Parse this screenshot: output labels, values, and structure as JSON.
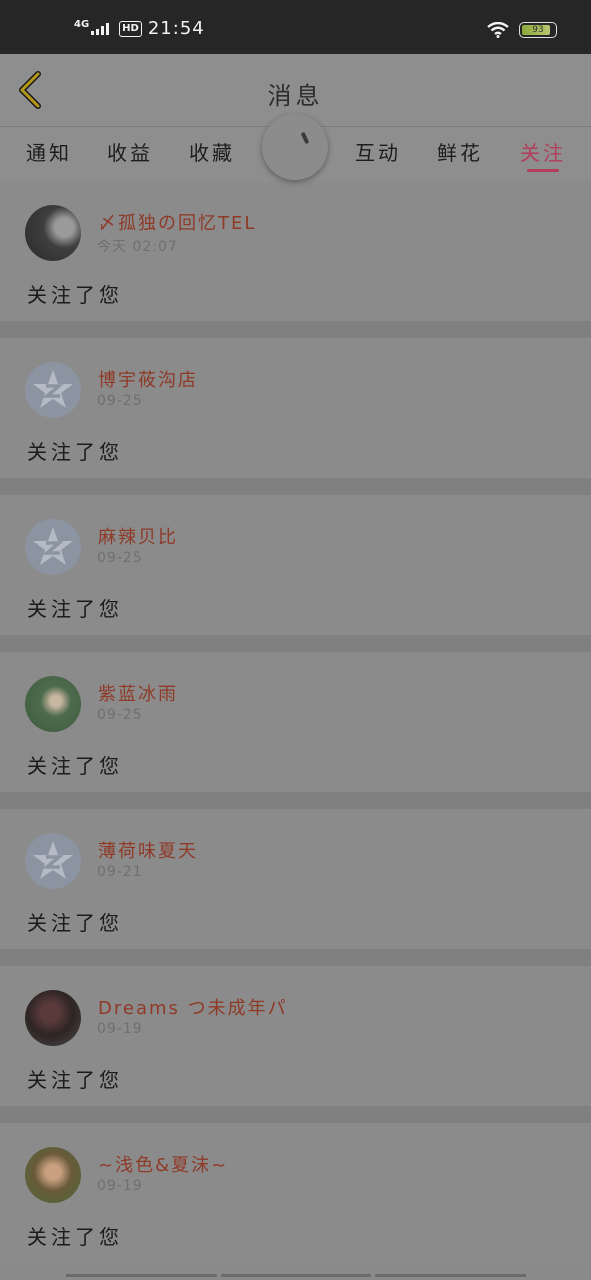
{
  "status_bar": {
    "network": "4G",
    "hd": "HD",
    "time": "21:54",
    "battery": "93",
    "icons": [
      "signal-icon",
      "wifi-icon",
      "battery-icon"
    ]
  },
  "header": {
    "title": "消息",
    "back_icon": "chevron-left-icon"
  },
  "tabs": [
    {
      "label": "通知"
    },
    {
      "label": "收益"
    },
    {
      "label": "收藏"
    },
    {
      "label": "互动"
    },
    {
      "label": "鲜花"
    },
    {
      "label": "关注",
      "active": true
    }
  ],
  "feed": [
    {
      "name": "〆孤独の回忆TEL",
      "time": "今天 02:07",
      "message": "关注了您",
      "avatar": "photo-avatar"
    },
    {
      "name": "博宇莜沟店",
      "time": "09-25",
      "message": "关注了您",
      "avatar": "qq-default-avatar"
    },
    {
      "name": "麻辣贝比",
      "time": "09-25",
      "message": "关注了您",
      "avatar": "qq-default-avatar"
    },
    {
      "name": "紫蓝冰雨",
      "time": "09-25",
      "message": "关注了您",
      "avatar": "photo-avatar"
    },
    {
      "name": "薄荷味夏天",
      "time": "09-21",
      "message": "关注了您",
      "avatar": "qq-default-avatar"
    },
    {
      "name": "Dreams つ未成年パ",
      "time": "09-19",
      "message": "关注了您",
      "avatar": "photo-avatar"
    },
    {
      "name": "~浅色&夏沫~",
      "time": "09-19",
      "message": "关注了您",
      "avatar": "photo-avatar"
    }
  ],
  "colors": {
    "accent": "#b23d5c",
    "username": "#8e3a27",
    "statusbar": "#262626"
  }
}
